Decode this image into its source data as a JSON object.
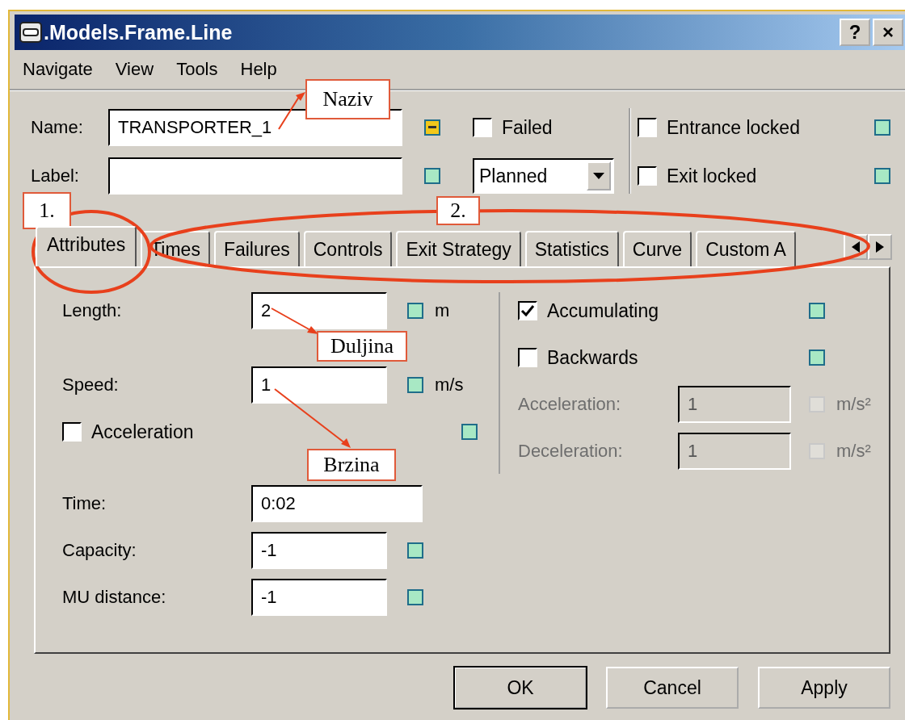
{
  "window": {
    "title": ".Models.Frame.Line",
    "buttons": [
      "?",
      "×"
    ]
  },
  "menu": [
    "Navigate",
    "View",
    "Tools",
    "Help"
  ],
  "header": {
    "name": {
      "label": "Name:",
      "value": "TRANSPORTER_1",
      "indicator": {
        "minus": true,
        "color": "#f2c81a"
      }
    },
    "label": {
      "label": "Label:",
      "indicator": {
        "minus": false,
        "color": "#a8e8c4"
      }
    },
    "failed": {
      "label": "Failed",
      "checked": false
    },
    "dropdown": {
      "value": "Planned"
    },
    "locks": [
      {
        "label": "Entrance locked",
        "checked": false,
        "indicator": {
          "minus": false,
          "color": "#a8e8c4"
        }
      },
      {
        "label": "Exit locked",
        "checked": false,
        "indicator": {
          "minus": false,
          "color": "#a8e8c4"
        }
      }
    ]
  },
  "tabs": [
    {
      "label": "Attributes",
      "selected": true
    },
    {
      "label": "Times",
      "selected": false
    },
    {
      "label": "Failures",
      "selected": false
    },
    {
      "label": "Controls",
      "selected": false
    },
    {
      "label": "Exit Strategy",
      "selected": false
    },
    {
      "label": "Statistics",
      "selected": false
    },
    {
      "label": "Curve",
      "selected": false
    },
    {
      "label": "Custom A",
      "selected": false
    }
  ],
  "attributes": {
    "left": [
      {
        "kind": "field",
        "label": "Length:",
        "value": "2",
        "unit": "m",
        "indicator": {
          "minus": false,
          "color": "#a8e8c4"
        }
      },
      {
        "kind": "field",
        "label": "Speed:",
        "value": "1",
        "unit": "m/s",
        "indicator": {
          "minus": false,
          "color": "#a8e8c4"
        }
      },
      {
        "kind": "checkbox",
        "label": "Acceleration",
        "checked": false,
        "indicator": {
          "minus": false,
          "color": "#a8e8c4"
        }
      }
    ],
    "right": [
      {
        "kind": "checkbox",
        "label": "Accumulating",
        "checked": true,
        "indicator": {
          "minus": false,
          "color": "#a8e8c4"
        }
      },
      {
        "kind": "checkbox",
        "label": "Backwards",
        "checked": false,
        "indicator": {
          "minus": false,
          "color": "#a8e8c4"
        }
      },
      {
        "kind": "field",
        "label": "Acceleration:",
        "value": "1",
        "unit": "m/s²",
        "disabled": true
      },
      {
        "kind": "field",
        "label": "Deceleration:",
        "value": "1",
        "unit": "m/s²",
        "disabled": true
      }
    ],
    "bottom": [
      {
        "label": "Time:",
        "value": "0:02"
      },
      {
        "label": "Capacity:",
        "value": "-1",
        "indicator": {
          "minus": false,
          "color": "#a8e8c4"
        }
      },
      {
        "label": "MU distance:",
        "value": "-1",
        "indicator": {
          "minus": false,
          "color": "#a8e8c4"
        }
      }
    ]
  },
  "buttons": [
    {
      "label": "OK",
      "default": true
    },
    {
      "label": "Cancel",
      "default": false
    },
    {
      "label": "Apply",
      "default": false
    }
  ],
  "annotations": [
    {
      "text": "Naziv"
    },
    {
      "text": "Duljina"
    },
    {
      "text": "Brzina"
    },
    {
      "text": "1."
    },
    {
      "text": "2."
    }
  ]
}
